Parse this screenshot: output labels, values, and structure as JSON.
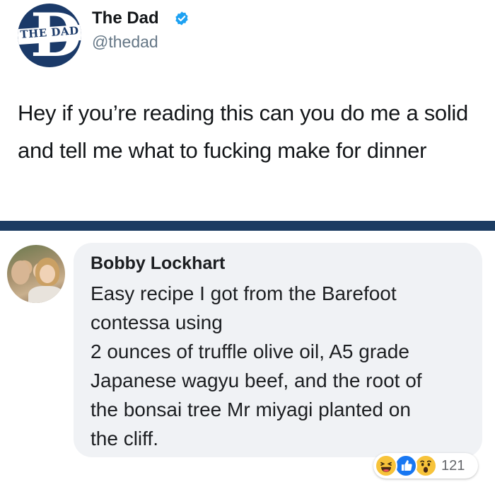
{
  "tweet": {
    "logo_text": "THE DAD",
    "display_name": "The Dad",
    "handle": "@thedad",
    "verified": true,
    "text": "Hey if you’re reading this can you do me a solid and tell me what to fucking make for dinner"
  },
  "comment": {
    "author": "Bobby Lockhart",
    "text_lines": [
      "Easy recipe I got from the Barefoot",
      "contessa using",
      "2 ounces of truffle olive oil,  A5 grade",
      "Japanese wagyu beef, and the root of",
      "the bonsai tree Mr miyagi planted on",
      "the cliff."
    ],
    "reactions": {
      "icons": [
        "haha-icon",
        "like-icon",
        "wow-icon"
      ],
      "count": "121"
    }
  },
  "colors": {
    "brand_navy": "#1b3a69",
    "divider": "#1c3c62",
    "verified_blue": "#1da1f2",
    "bubble_bg": "#f0f2f5",
    "handle_gray": "#657786"
  }
}
